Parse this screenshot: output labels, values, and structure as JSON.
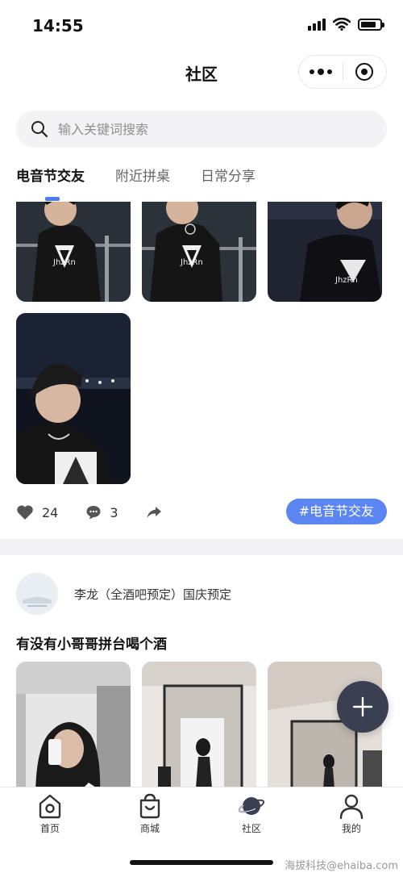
{
  "status_bar": {
    "time": "14:55"
  },
  "nav": {
    "title": "社区"
  },
  "search": {
    "placeholder": "输入关键词搜索"
  },
  "tabs": [
    {
      "label": "电音节交友",
      "active": true
    },
    {
      "label": "附近拼桌",
      "active": false
    },
    {
      "label": "日常分享",
      "active": false
    }
  ],
  "post1": {
    "likes": "24",
    "comments": "3",
    "hashtag": "#电音节交友"
  },
  "post2": {
    "author": "李龙（全酒吧预定）国庆预定",
    "title": "有没有小哥哥拼台喝个酒"
  },
  "tabbar": [
    {
      "label": "首页",
      "icon": "home-icon"
    },
    {
      "label": "商城",
      "icon": "shopping-bag-icon"
    },
    {
      "label": "社区",
      "icon": "planet-icon",
      "active": true
    },
    {
      "label": "我的",
      "icon": "person-icon"
    }
  ],
  "watermark": "海拔科技@ehaiba.com",
  "colors": {
    "accent": "#5b86f1",
    "fab": "#3a4052"
  }
}
